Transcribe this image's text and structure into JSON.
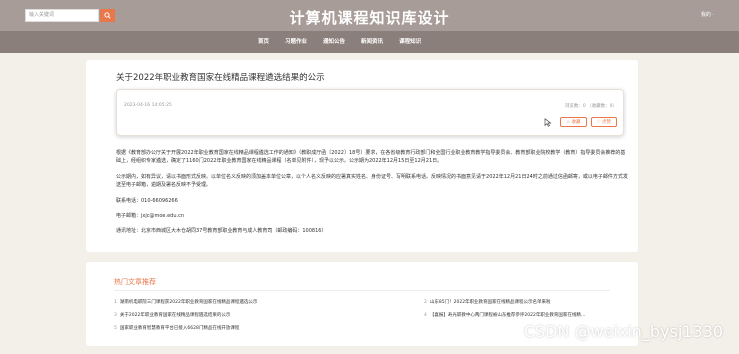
{
  "header": {
    "search_placeholder": "输入关键词",
    "site_title": "计算机课程知识库设计",
    "login": "我的 ·"
  },
  "nav": {
    "items": [
      "首页",
      "习题作业",
      "通知公告",
      "新闻资讯",
      "课程知识"
    ]
  },
  "article": {
    "title": "关于2022年职业教育国家在线精品课程遴选结果的公示",
    "date": "2023-04-16 14:05:25",
    "stats": "浏览数：0 （收藏数：0）",
    "actions": [
      "收藏",
      "点赞"
    ],
    "paragraphs": [
      "根据《教育部办公厅关于开展2022年职业教育国家在线精品课程遴选工作的通知》（教职成厅函〔2022〕18号）要求，在各省级教育行政部门和全国行业职业教育教学指导委员会、教育部职业院校教学（教育）指导委员会推荐的基础上，经组织专家遴选，确定了1160门2022年职业教育国家在线精品课程（名单见附件），现予以公示。公示期为2022年12月15日至12月21日。",
      "公示期内，如有异议，请以书面形式反映。以单位名义反映的须加盖本单位公章，以个人名义反映的应署真实姓名、身份证号、写明联系电话。反映情况的书面意见请于2022年12月21日24时之前通过信函邮寄，或以电子邮件方式发送至电子邮箱，逾期及署名反映不予受理。",
      "联系电话：010-66096266",
      "电子邮箱：jxjc@moe.edu.cn",
      "通讯地址：北京市西城区大木仓胡同37号教育部职业教育与成人教育司（邮政编码：100816）"
    ]
  },
  "hot": {
    "title": "热门文章推荐",
    "items": [
      {
        "num": "1",
        "text": "湖南机电职院三门课程获2022年职业教育国家在线精品课程遴选公示"
      },
      {
        "num": "2",
        "text": "山东85门！2022年职业教育国家在线精品课程公示名单来啦"
      },
      {
        "num": "3",
        "text": "关于2022年职业教育国家在线精品课程遴选结果的公示"
      },
      {
        "num": "4",
        "text": "【喜报】寿光职教中心两门课程被山东推荐参评2022年职业教育国家在线精…"
      },
      {
        "num": "5",
        "text": "国家职业教育智慧教育平台已接入6628门精品在线开放课程"
      }
    ]
  },
  "watermark": "CSDN @weixin_bysj1330",
  "colors": {
    "topbar": "#a79c98",
    "navbar": "#8b7f7b",
    "accent": "#e8784a",
    "background": "#f3efe9"
  }
}
